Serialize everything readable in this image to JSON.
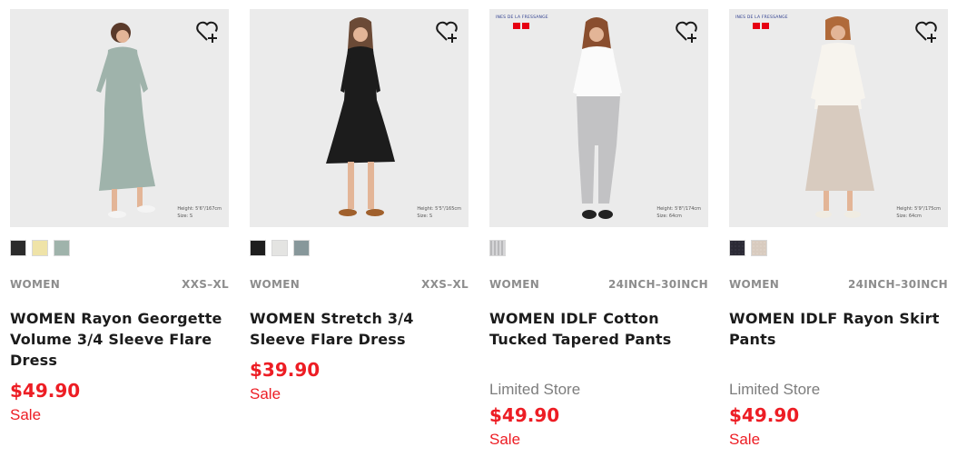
{
  "products": [
    {
      "gender": "WOMEN",
      "size_range": "XXS–XL",
      "name": "WOMEN Rayon Georgette Volume 3/4 Sleeve Flare Dress",
      "price": "$49.90",
      "sale_label": "Sale",
      "height_note": "Height: 5'6\"/167cm",
      "size_note": "Size: S",
      "swatches": [
        "#2b2b2b",
        "#efe3a8",
        "#9fb3ab"
      ],
      "image_bg": "#ebebeb"
    },
    {
      "gender": "WOMEN",
      "size_range": "XXS–XL",
      "name": "WOMEN Stretch 3/4 Sleeve Flare Dress",
      "price": "$39.90",
      "sale_label": "Sale",
      "height_note": "Height: 5'5\"/165cm",
      "size_note": "Size: S",
      "swatches": [
        "#1e1e1e",
        "#e4e4e2",
        "#87979a"
      ],
      "image_bg": "#ebebeb"
    },
    {
      "gender": "WOMEN",
      "size_range": "24INCH–30INCH",
      "name": "WOMEN IDLF Cotton Tucked Tapered Pants",
      "store_label": "Limited Store",
      "price": "$49.90",
      "sale_label": "Sale",
      "brand_tag": "INES DE LA FRESSANGE",
      "height_note": "Height: 5'8\"/174cm",
      "size_note": "Size: 64cm",
      "swatches": [
        "#c2c2c4"
      ],
      "image_bg": "#ebebeb"
    },
    {
      "gender": "WOMEN",
      "size_range": "24INCH–30INCH",
      "name": "WOMEN IDLF Rayon Skirt Pants",
      "store_label": "Limited Store",
      "price": "$49.90",
      "sale_label": "Sale",
      "brand_tag": "INES DE LA FRESSANGE",
      "height_note": "Height: 5'9\"/175cm",
      "size_note": "Size: 64cm",
      "swatches": [
        "#2b2a35",
        "#d8cbbf"
      ],
      "image_bg": "#ebebeb"
    }
  ],
  "icons": {
    "favorite": "heart-plus-icon"
  },
  "colors": {
    "price": "#ed1d24",
    "meta": "#8d8d8d",
    "text": "#1b1b1b"
  }
}
